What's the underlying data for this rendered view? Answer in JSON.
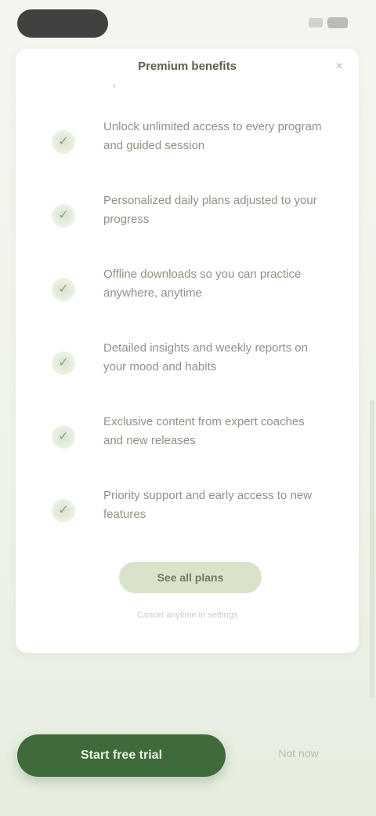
{
  "header": {
    "title": "Premium benefits",
    "close_glyph": "×",
    "back_glyph": "‹"
  },
  "benefits": [
    {
      "icon": "check-icon",
      "glyph": "✓",
      "text": "Unlock unlimited access to every program and guided session"
    },
    {
      "icon": "check-icon",
      "glyph": "✓",
      "text": "Personalized daily plans adjusted to your progress"
    },
    {
      "icon": "check-icon",
      "glyph": "✓",
      "text": "Offline downloads so you can practice anywhere, anytime"
    },
    {
      "icon": "check-icon",
      "glyph": "✓",
      "text": "Detailed insights and weekly reports on your mood and habits"
    },
    {
      "icon": "check-icon",
      "glyph": "✓",
      "text": "Exclusive content from expert coaches and new releases"
    },
    {
      "icon": "check-icon",
      "glyph": "✓",
      "text": "Priority support and early access to new features"
    }
  ],
  "inline_cta": "See all plans",
  "card_footer": "Cancel anytime in settings",
  "bottom": {
    "primary_label": "Start free trial",
    "secondary_label": "Not now"
  },
  "colors": {
    "primary": "#3f6a3b",
    "accent_light": "#d8e3c9",
    "background": "#eef2e8"
  }
}
